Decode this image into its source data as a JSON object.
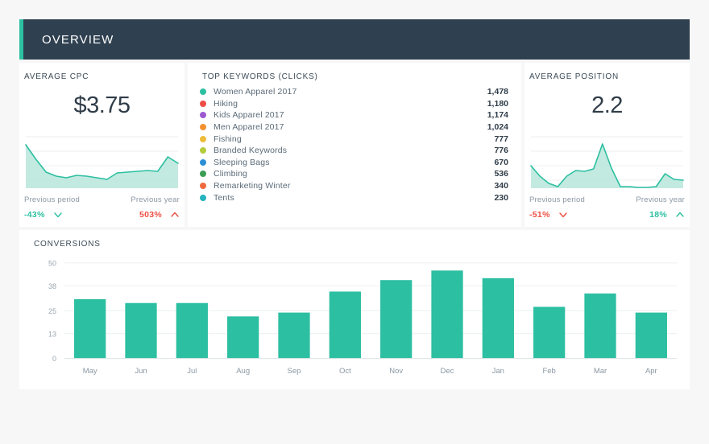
{
  "header": {
    "title": "OVERVIEW",
    "accent_color": "#2cbfa1",
    "bg_color": "#2f4050"
  },
  "cpc_card": {
    "title": "AVERAGE CPC",
    "value": "$3.75",
    "previous_period_label": "Previous period",
    "previous_period_value": "-43%",
    "previous_period_direction": "down",
    "previous_period_color": "#2cbfa1",
    "previous_year_label": "Previous year",
    "previous_year_value": "503%",
    "previous_year_direction": "up",
    "previous_year_color": "#ed4f43",
    "sparkline": {
      "type": "area",
      "line_color": "#2cbfa1",
      "fill_color": "#b8e6da",
      "values": [
        50,
        30,
        15,
        10,
        8,
        11,
        10,
        8,
        6,
        14,
        15,
        16,
        17,
        16,
        30,
        22
      ]
    }
  },
  "keywords_card": {
    "title": "TOP KEYWORDS (CLICKS)",
    "rows": [
      {
        "label": "Women Apparel 2017",
        "value": "1,478",
        "color": "#2cbfa1"
      },
      {
        "label": "Hiking",
        "value": "1,180",
        "color": "#ee4d45"
      },
      {
        "label": "Kids Apparel 2017",
        "value": "1,174",
        "color": "#9b59d0"
      },
      {
        "label": "Men Apparel 2017",
        "value": "1,024",
        "color": "#f3902f"
      },
      {
        "label": "Fishing",
        "value": "777",
        "color": "#edbc38"
      },
      {
        "label": "Branded Keywords",
        "value": "776",
        "color": "#b4cc3c"
      },
      {
        "label": "Sleeping Bags",
        "value": "670",
        "color": "#2b8fd6"
      },
      {
        "label": "Climbing",
        "value": "536",
        "color": "#3c9d55"
      },
      {
        "label": "Remarketing Winter",
        "value": "340",
        "color": "#ef6a3c"
      },
      {
        "label": "Tents",
        "value": "230",
        "color": "#24b3bf"
      }
    ]
  },
  "position_card": {
    "title": "AVERAGE POSITION",
    "value": "2.2",
    "previous_period_label": "Previous period",
    "previous_period_value": "-51%",
    "previous_period_direction": "down",
    "previous_period_color": "#ed4f43",
    "previous_year_label": "Previous year",
    "previous_year_value": "18%",
    "previous_year_direction": "up",
    "previous_year_color": "#2cbfa1",
    "sparkline": {
      "type": "area",
      "line_color": "#2cbfa1",
      "fill_color": "#b8e6da",
      "values": [
        25,
        14,
        8,
        5,
        14,
        19,
        18,
        21,
        50,
        22,
        5,
        5,
        4,
        4,
        5,
        16,
        11,
        10
      ]
    }
  },
  "conversions_card": {
    "title": "CONVERSIONS"
  },
  "chart_data": {
    "type": "bar",
    "title": "CONVERSIONS",
    "xlabel": "",
    "ylabel": "",
    "categories": [
      "May",
      "Jun",
      "Jul",
      "Aug",
      "Sep",
      "Oct",
      "Nov",
      "Dec",
      "Jan",
      "Feb",
      "Mar",
      "Apr"
    ],
    "values": [
      31,
      29,
      29,
      22,
      24,
      35,
      41,
      46,
      42,
      27,
      34,
      24
    ],
    "yticks": [
      0,
      13,
      25,
      38,
      50
    ],
    "ytick_labels": [
      "0",
      "13",
      "25",
      "38",
      "50"
    ],
    "ylim": [
      0,
      52
    ],
    "bar_color": "#2cbfa1",
    "grid": true,
    "legend": false
  }
}
